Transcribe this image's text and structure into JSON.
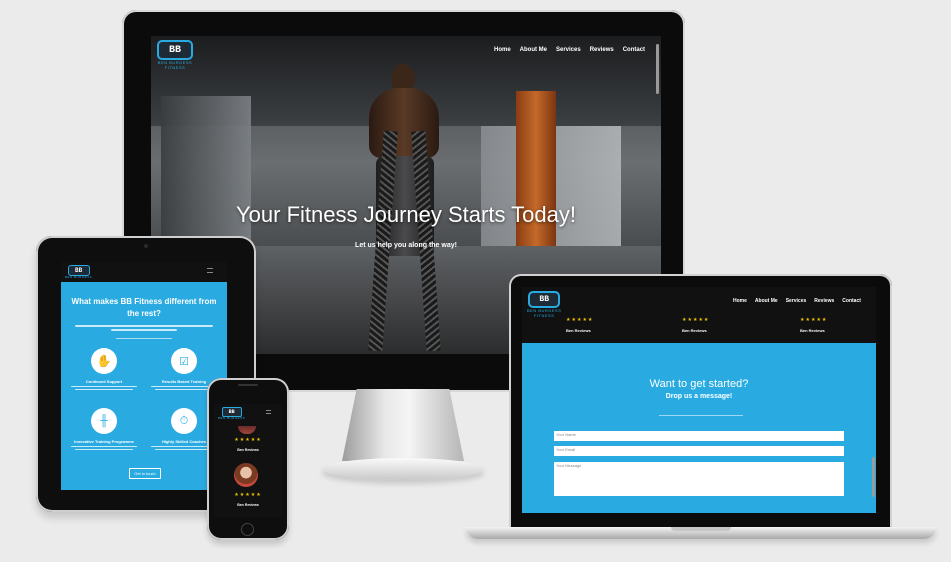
{
  "logo": {
    "mark": "BB",
    "text": "BEN BURGESS",
    "subtext": "FITNESS"
  },
  "nav": {
    "home": "Home",
    "about": "About Me",
    "services": "Services",
    "reviews": "Reviews",
    "contact": "Contact"
  },
  "hero": {
    "title": "Your Fitness Journey Starts Today!",
    "subtitle": "Let us help you along the way!"
  },
  "about": {
    "heading": "What makes BB Fitness different from the rest?",
    "features": [
      {
        "title": "Continued Support"
      },
      {
        "title": "Results Based Training"
      },
      {
        "title": "Innovative Training Programme"
      },
      {
        "title": "Highly Skilled Coaches"
      }
    ],
    "cta": "Get in touch"
  },
  "reviews": {
    "stars": "★★★★★",
    "name": "Ben Reviews"
  },
  "contact": {
    "heading": "Want to get started?",
    "subheading": "Drop us a message!",
    "name_placeholder": "Your Name",
    "email_placeholder": "Your Email",
    "message_placeholder": "Your Message"
  },
  "colors": {
    "accent": "#29abe2",
    "dark": "#111111",
    "star": "#f2c200"
  }
}
